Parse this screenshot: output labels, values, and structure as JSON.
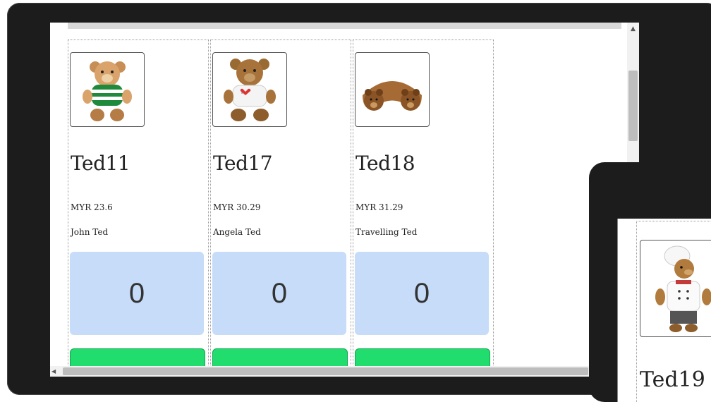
{
  "products": [
    {
      "title": "Ted11",
      "price": "MYR 23.6",
      "name": "John Ted",
      "qty": "0"
    },
    {
      "title": "Ted17",
      "price": "MYR 30.29",
      "name": "Angela Ted",
      "qty": "0"
    },
    {
      "title": "Ted18",
      "price": "MYR 31.29",
      "name": "Travelling Ted",
      "qty": "0"
    }
  ],
  "secondary": {
    "title": "Ted19"
  },
  "colors": {
    "bezel": "#1c1c1c",
    "qty_bg": "#c6dcf9",
    "add_button": "#20dd6e"
  },
  "icons": {
    "scroll_up": "▲",
    "scroll_left": "◀"
  }
}
